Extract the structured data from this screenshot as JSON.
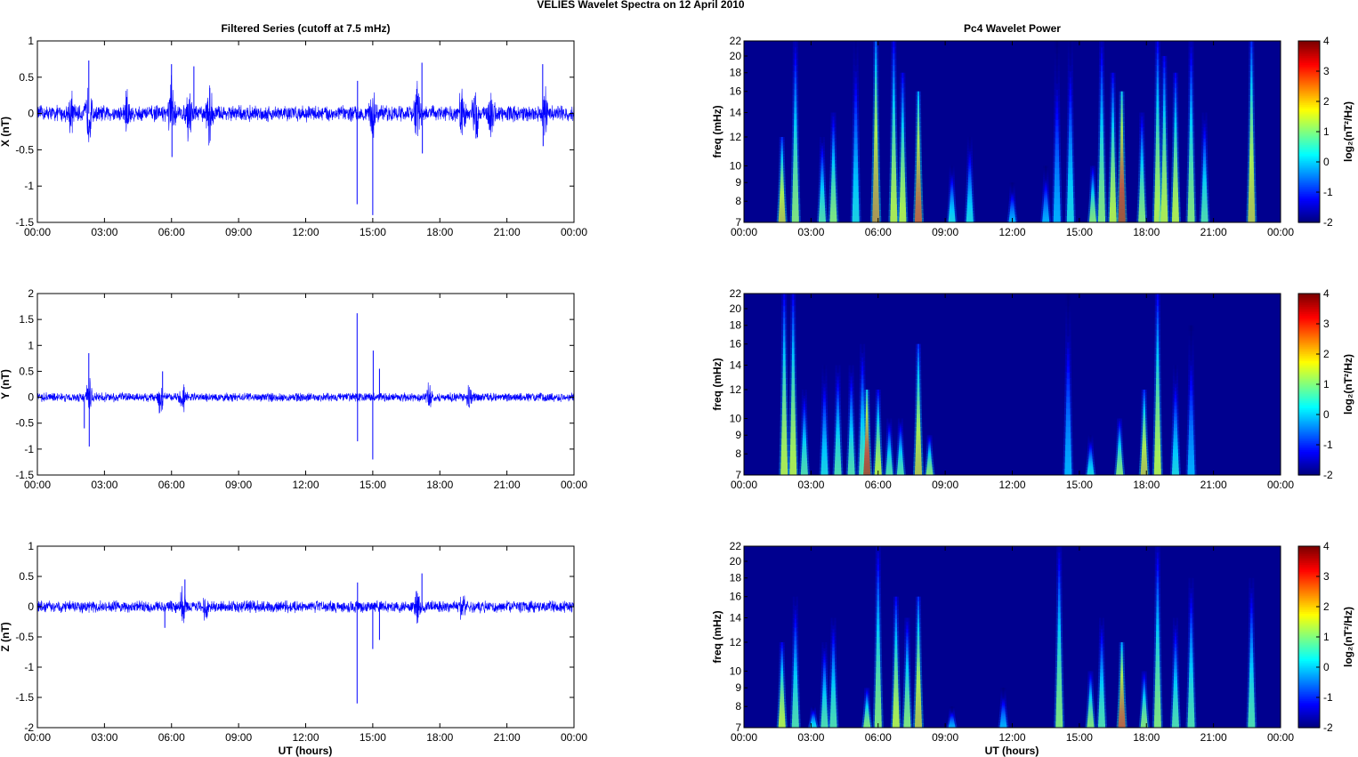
{
  "title": "VELIES Wavelet Spectra on 12 April    2010",
  "time_ticks": [
    "00:00",
    "03:00",
    "06:00",
    "09:00",
    "12:00",
    "15:00",
    "18:00",
    "21:00",
    "00:00"
  ],
  "colormap_ticks": [
    "4",
    "3",
    "2",
    "1",
    "0",
    "-1",
    "-2"
  ],
  "freq_ticks": [
    "22",
    "20",
    "18",
    "16",
    "14",
    "12",
    "10",
    "9",
    "8",
    "7"
  ],
  "chart_data": [
    {
      "type": "line",
      "title": "Filtered Series (cutoff at 7.5 mHz)",
      "ylabel": "X (nT)",
      "xlabel": "",
      "xlim": [
        0,
        24
      ],
      "ylim": [
        -1.5,
        1
      ],
      "yticks": [
        "1",
        "0.5",
        "0",
        "-0.5",
        "-1",
        "-1.5"
      ],
      "color": "#0000ff",
      "noise_amplitude": 0.09,
      "bursts": [
        [
          1.5,
          0.2
        ],
        [
          2.3,
          0.3
        ],
        [
          4.0,
          0.25
        ],
        [
          6.0,
          0.35
        ],
        [
          6.8,
          0.3
        ],
        [
          7.7,
          0.3
        ],
        [
          15.0,
          0.2
        ],
        [
          17.0,
          0.35
        ],
        [
          19.0,
          0.3
        ],
        [
          19.6,
          0.3
        ],
        [
          20.3,
          0.25
        ],
        [
          22.7,
          0.2
        ]
      ],
      "spikes": [
        [
          2.3,
          0.73
        ],
        [
          6.0,
          0.68
        ],
        [
          6.02,
          -0.6
        ],
        [
          7.0,
          0.65
        ],
        [
          14.3,
          -1.25
        ],
        [
          14.32,
          0.45
        ],
        [
          15.0,
          -1.4
        ],
        [
          17.2,
          0.7
        ],
        [
          17.22,
          -0.55
        ],
        [
          22.6,
          0.68
        ],
        [
          22.62,
          -0.45
        ]
      ]
    },
    {
      "type": "line",
      "title": "",
      "ylabel": "Y (nT)",
      "xlabel": "",
      "xlim": [
        0,
        24
      ],
      "ylim": [
        -1.5,
        2
      ],
      "yticks": [
        "2",
        "1.5",
        "1",
        "0.5",
        "0",
        "-0.5",
        "-1",
        "-1.5"
      ],
      "color": "#0000ff",
      "noise_amplitude": 0.07,
      "bursts": [
        [
          2.3,
          0.25
        ],
        [
          5.5,
          0.2
        ],
        [
          6.5,
          0.2
        ],
        [
          17.5,
          0.15
        ],
        [
          19.3,
          0.15
        ]
      ],
      "spikes": [
        [
          2.3,
          0.85
        ],
        [
          2.32,
          -0.95
        ],
        [
          2.1,
          -0.6
        ],
        [
          14.3,
          1.62
        ],
        [
          14.32,
          -0.85
        ],
        [
          15.0,
          -1.2
        ],
        [
          15.02,
          0.9
        ],
        [
          15.3,
          0.55
        ],
        [
          5.6,
          0.5
        ]
      ]
    },
    {
      "type": "line",
      "title": "",
      "ylabel": "Z (nT)",
      "xlabel": "UT (hours)",
      "xlim": [
        0,
        24
      ],
      "ylim": [
        -2,
        1
      ],
      "yticks": [
        "1",
        "0.5",
        "0",
        "-0.5",
        "-1",
        "-1.5",
        "-2"
      ],
      "color": "#0000ff",
      "noise_amplitude": 0.08,
      "bursts": [
        [
          6.5,
          0.2
        ],
        [
          7.5,
          0.15
        ],
        [
          17.0,
          0.2
        ],
        [
          19.0,
          0.15
        ]
      ],
      "spikes": [
        [
          14.3,
          -1.6
        ],
        [
          14.32,
          0.4
        ],
        [
          15.0,
          -0.7
        ],
        [
          15.3,
          -0.55
        ],
        [
          17.2,
          0.55
        ],
        [
          6.6,
          0.45
        ],
        [
          5.7,
          -0.35
        ]
      ]
    },
    {
      "type": "heatmap",
      "title": "Pc4 Wavelet Power",
      "ylabel": "freq (mHz)",
      "xlabel": "",
      "xlim": [
        0,
        24
      ],
      "ylim": [
        7,
        22
      ],
      "yscale": "log",
      "clim": [
        -2,
        4
      ],
      "colorbar_label": "log₂(nT²/Hz)",
      "events_hour_topfreq_peakpower": [
        [
          1.7,
          12,
          2
        ],
        [
          2.3,
          22,
          1
        ],
        [
          3.5,
          12,
          0.5
        ],
        [
          4.0,
          14,
          1
        ],
        [
          5.0,
          22,
          0
        ],
        [
          5.9,
          22,
          2.5
        ],
        [
          6.7,
          22,
          1.5
        ],
        [
          7.1,
          18,
          1.5
        ],
        [
          7.8,
          16,
          3
        ],
        [
          9.3,
          10,
          0
        ],
        [
          10.1,
          12,
          0
        ],
        [
          12.0,
          9,
          -0.5
        ],
        [
          13.5,
          10,
          -0.5
        ],
        [
          14.0,
          22,
          -0.5
        ],
        [
          14.6,
          22,
          0
        ],
        [
          15.6,
          10,
          1
        ],
        [
          16.0,
          22,
          1
        ],
        [
          16.5,
          18,
          1.5
        ],
        [
          16.9,
          16,
          3.5
        ],
        [
          17.8,
          14,
          1
        ],
        [
          18.5,
          22,
          1.5
        ],
        [
          18.8,
          20,
          1.5
        ],
        [
          19.3,
          18,
          1.5
        ],
        [
          20.0,
          22,
          1
        ],
        [
          20.6,
          14,
          0.5
        ],
        [
          22.7,
          22,
          2
        ]
      ]
    },
    {
      "type": "heatmap",
      "title": "",
      "ylabel": "freq (mHz)",
      "xlabel": "",
      "xlim": [
        0,
        24
      ],
      "ylim": [
        7,
        22
      ],
      "yscale": "log",
      "clim": [
        -2,
        4
      ],
      "colorbar_label": "log₂(nT²/Hz)",
      "events_hour_topfreq_peakpower": [
        [
          1.8,
          22,
          1.5
        ],
        [
          2.2,
          22,
          1.5
        ],
        [
          2.7,
          12,
          0.5
        ],
        [
          3.6,
          14,
          0
        ],
        [
          4.2,
          14,
          0.5
        ],
        [
          4.8,
          14,
          0.5
        ],
        [
          5.3,
          16,
          0.5
        ],
        [
          5.5,
          12,
          3.5
        ],
        [
          6.0,
          12,
          1.5
        ],
        [
          6.5,
          10,
          0.5
        ],
        [
          7.0,
          10,
          0.5
        ],
        [
          7.8,
          16,
          2
        ],
        [
          8.3,
          9,
          1
        ],
        [
          14.5,
          22,
          -0.5
        ],
        [
          15.5,
          9,
          0
        ],
        [
          16.8,
          10,
          1
        ],
        [
          17.9,
          12,
          2
        ],
        [
          18.5,
          22,
          1.5
        ],
        [
          19.3,
          14,
          0
        ],
        [
          20.0,
          18,
          -0.5
        ]
      ]
    },
    {
      "type": "heatmap",
      "title": "",
      "ylabel": "freq (mHz)",
      "xlabel": "UT (hours)",
      "xlim": [
        0,
        24
      ],
      "ylim": [
        7,
        22
      ],
      "yscale": "log",
      "clim": [
        -2,
        4
      ],
      "colorbar_label": "log₂(nT²/Hz)",
      "events_hour_topfreq_peakpower": [
        [
          1.7,
          12,
          1.5
        ],
        [
          2.3,
          16,
          0.5
        ],
        [
          3.1,
          8,
          0
        ],
        [
          3.6,
          12,
          0.5
        ],
        [
          4.0,
          14,
          0.5
        ],
        [
          5.5,
          9,
          1
        ],
        [
          6.0,
          22,
          1
        ],
        [
          6.8,
          16,
          1.5
        ],
        [
          7.3,
          14,
          1
        ],
        [
          7.8,
          16,
          2
        ],
        [
          9.3,
          8,
          -0.5
        ],
        [
          11.6,
          9,
          -0.5
        ],
        [
          14.1,
          22,
          1
        ],
        [
          15.5,
          10,
          1
        ],
        [
          16.0,
          14,
          0.5
        ],
        [
          16.9,
          12,
          3
        ],
        [
          17.9,
          10,
          1
        ],
        [
          18.5,
          22,
          1
        ],
        [
          19.3,
          14,
          0.5
        ],
        [
          20.0,
          18,
          0.5
        ],
        [
          22.7,
          18,
          0.5
        ]
      ]
    }
  ]
}
